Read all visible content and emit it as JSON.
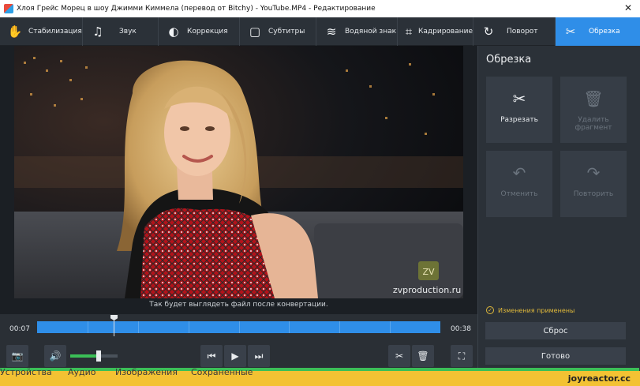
{
  "window": {
    "title": "Хлоя Грейс Морец в шоу Джимми Киммела (перевод от Bitchy) - YouTube.MP4 - Редактирование",
    "close_glyph": "✕"
  },
  "tabs": [
    {
      "label": "Стабилизация",
      "icon": "hand-stabilize-icon",
      "glyph": "✋"
    },
    {
      "label": "Звук",
      "icon": "music-note-icon",
      "glyph": "♫"
    },
    {
      "label": "Коррекция",
      "icon": "contrast-icon",
      "glyph": "◐"
    },
    {
      "label": "Субтитры",
      "icon": "speech-bubble-icon",
      "glyph": "▢"
    },
    {
      "label": "Водяной знак",
      "icon": "watermark-icon",
      "glyph": "≋"
    },
    {
      "label": "Кадрирование",
      "icon": "crop-icon",
      "glyph": "⌗"
    },
    {
      "label": "Поворот",
      "icon": "rotate-icon",
      "glyph": "↻"
    },
    {
      "label": "Обрезка",
      "icon": "scissors-icon",
      "glyph": "✂"
    }
  ],
  "active_tab": "Обрезка",
  "video": {
    "watermark_text": "zvproduction.ru",
    "watermark_logo": "ZV"
  },
  "preview_caption": "Так будет выглядеть файл после конвертации.",
  "timeline": {
    "start_time": "00:07",
    "end_time": "00:38",
    "playhead_fraction": 0.19
  },
  "controls": {
    "volume_level": 0.6,
    "camera_icon": "camera-icon",
    "speaker_icon": "speaker-icon",
    "prev_icon": "skip-back-icon",
    "play_icon": "play-icon",
    "next_icon": "skip-forward-icon",
    "cut_icon": "scissors-icon",
    "delete_icon": "trash-icon",
    "fullscreen_icon": "fullscreen-icon"
  },
  "panel": {
    "title": "Обрезка",
    "tiles": [
      {
        "label": "Разрезать",
        "icon": "scissors-icon",
        "glyph": "✂",
        "enabled": true
      },
      {
        "label": "Удалить фрагмент",
        "icon": "trash-icon",
        "glyph": "🗑",
        "enabled": false
      },
      {
        "label": "Отменить",
        "icon": "undo-icon",
        "glyph": "↶",
        "enabled": false
      },
      {
        "label": "Повторить",
        "icon": "redo-icon",
        "glyph": "↷",
        "enabled": false
      }
    ],
    "status": "Изменения применены",
    "reset_label": "Сброс",
    "done_label": "Готово"
  },
  "background_tabs": [
    "Устройства",
    "Аудио",
    "Изображения",
    "Сохраненные"
  ],
  "site_watermark": "joyreactor.cc",
  "colors": {
    "accent": "#2f8ee8",
    "green": "#3bbf57",
    "status": "#e0b93a",
    "banner": "#f3c233"
  }
}
